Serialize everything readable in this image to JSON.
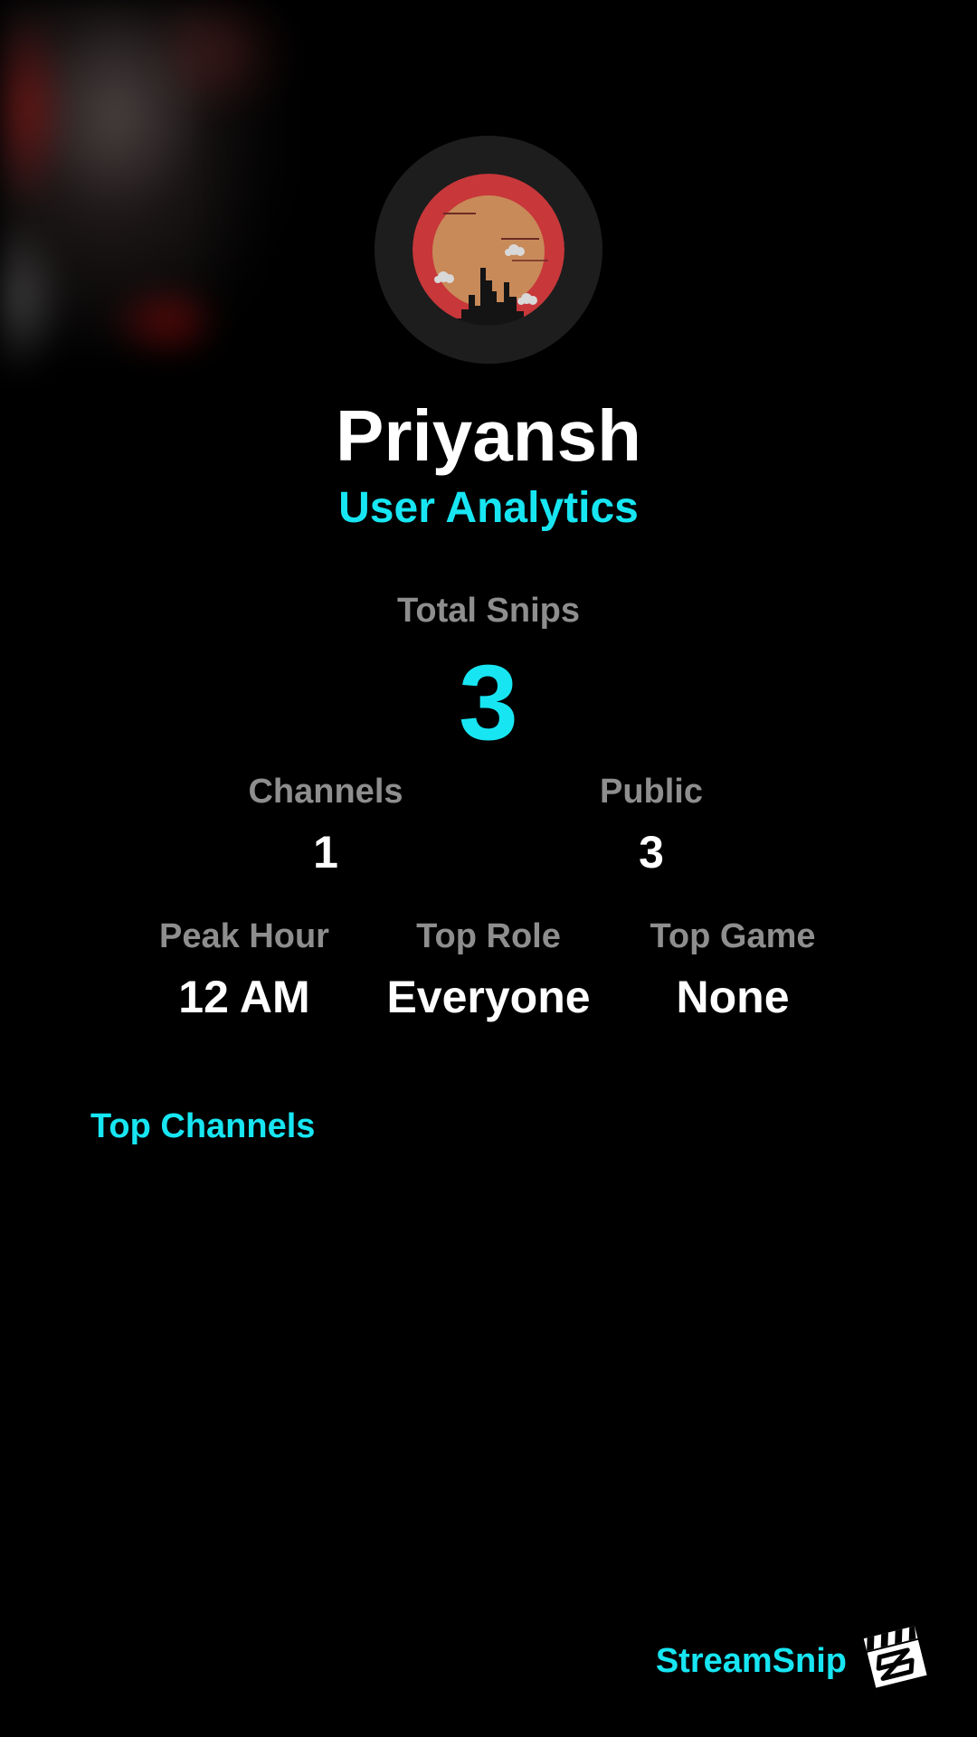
{
  "profile": {
    "username": "Priyansh",
    "subtitle": "User Analytics",
    "avatar_icon": "city-skyline-sunset-icon"
  },
  "stats": {
    "total_snips": {
      "label": "Total Snips",
      "value": "3"
    },
    "channels": {
      "label": "Channels",
      "value": "1"
    },
    "public": {
      "label": "Public",
      "value": "3"
    },
    "peak_hour": {
      "label": "Peak Hour",
      "value": "12 AM"
    },
    "top_role": {
      "label": "Top Role",
      "value": "Everyone"
    },
    "top_game": {
      "label": "Top Game",
      "value": "None"
    }
  },
  "top_channels": {
    "title": "Top Channels"
  },
  "footer": {
    "brand_name": "StreamSnip",
    "brand_icon": "clapperboard-logo-icon"
  },
  "colors": {
    "accent": "#17e6f2",
    "label": "#8e8e8e",
    "value": "#ffffff",
    "background": "#000000",
    "avatar_red": "#c8373a",
    "avatar_sun": "#c88a59"
  }
}
